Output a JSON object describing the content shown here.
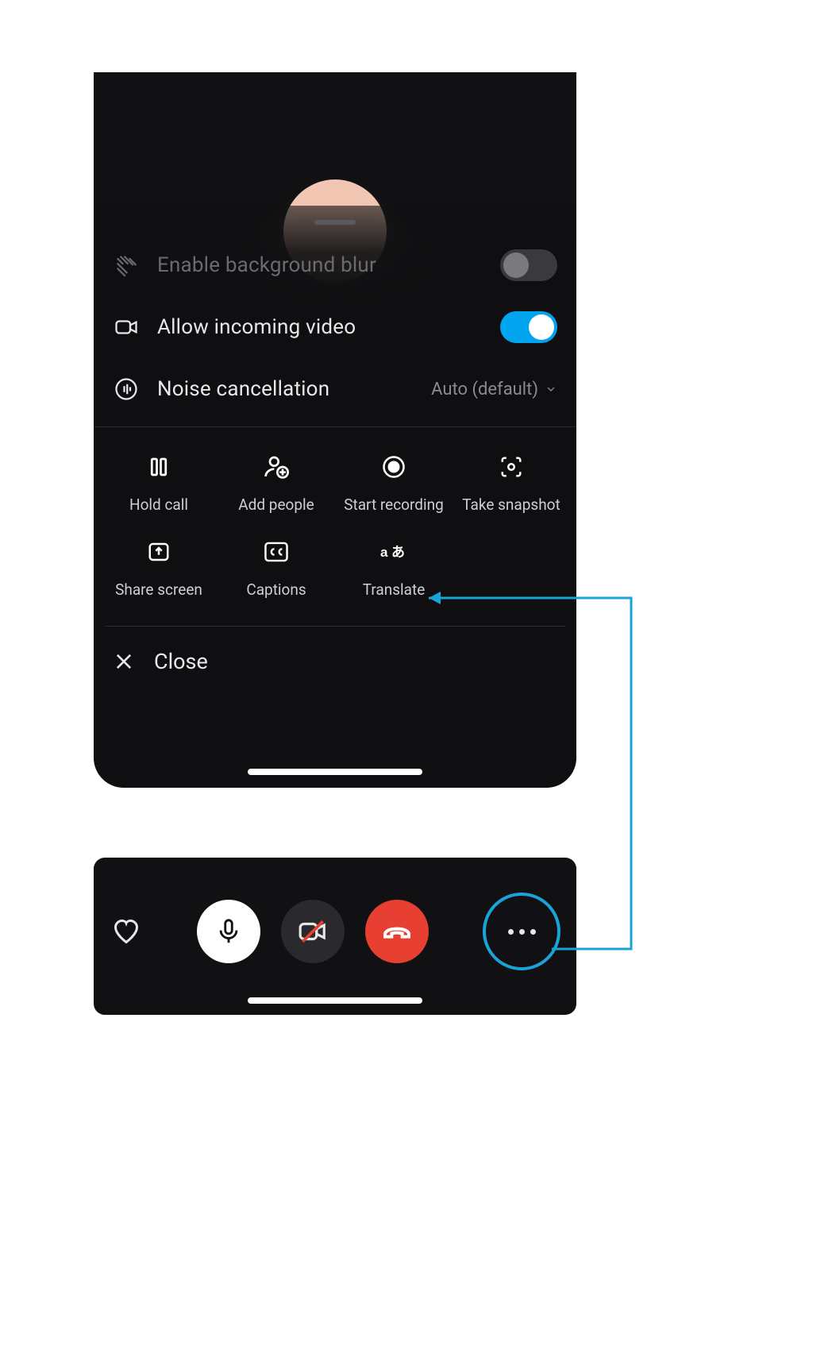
{
  "settings": {
    "blur": {
      "label": "Enable background blur",
      "on": false
    },
    "incoming": {
      "label": "Allow incoming video",
      "on": true
    },
    "noise": {
      "label": "Noise cancellation",
      "value": "Auto (default)"
    }
  },
  "actions": {
    "hold": {
      "label": "Hold call"
    },
    "add": {
      "label": "Add people"
    },
    "record": {
      "label": "Start recording"
    },
    "snapshot": {
      "label": "Take snapshot"
    },
    "share": {
      "label": "Share screen"
    },
    "captions": {
      "label": "Captions"
    },
    "translate": {
      "label": "Translate"
    }
  },
  "close_label": "Close",
  "colors": {
    "accent": "#00a4ef",
    "annotation": "#1aa3d9",
    "end_call": "#e74033"
  }
}
